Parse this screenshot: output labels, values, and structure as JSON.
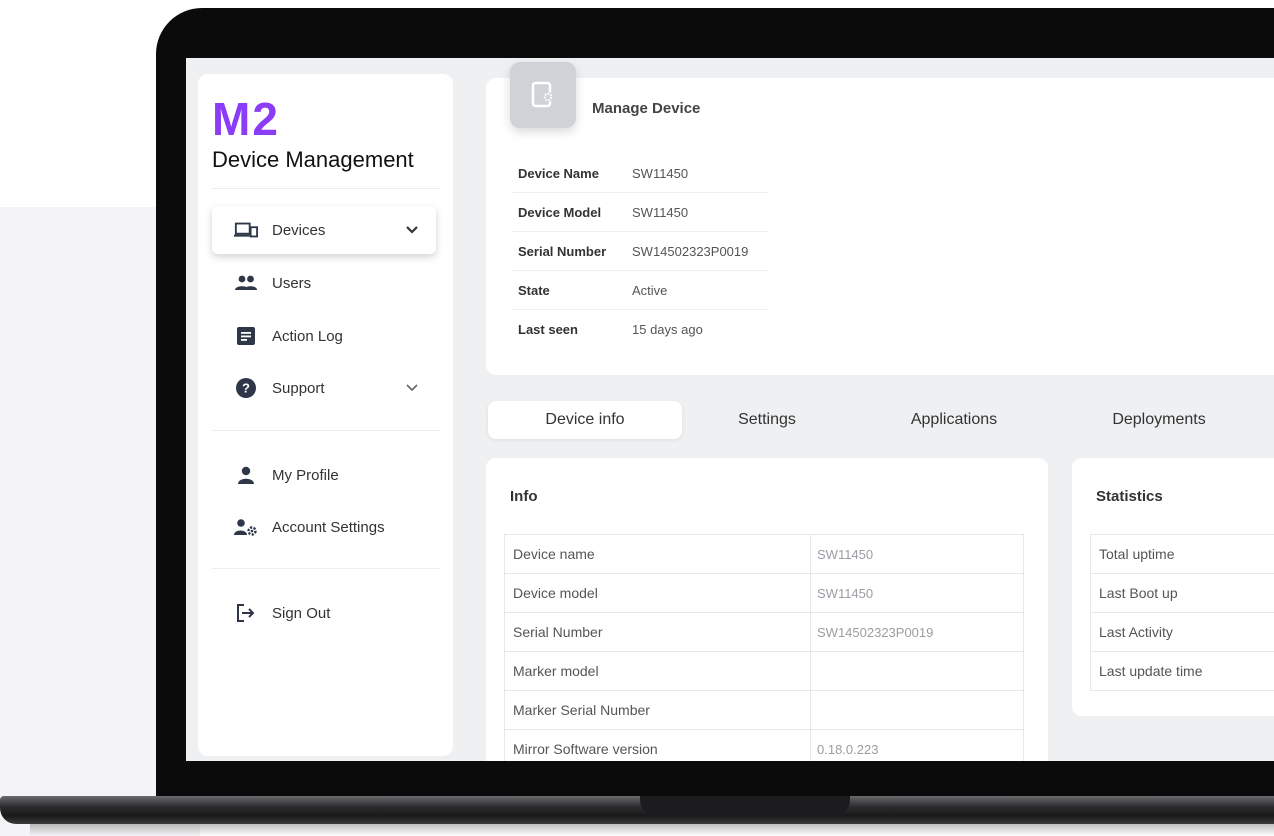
{
  "brand": {
    "mark": "M2",
    "title": "Device Management"
  },
  "sidebar": {
    "items": [
      {
        "label": "Devices",
        "icon": "devices-icon",
        "active": true,
        "has_chevron": true
      },
      {
        "label": "Users",
        "icon": "users-icon",
        "active": false,
        "has_chevron": false
      },
      {
        "label": "Action Log",
        "icon": "action-log-icon",
        "active": false,
        "has_chevron": false
      },
      {
        "label": "Support",
        "icon": "help-icon",
        "active": false,
        "has_chevron": true
      }
    ],
    "account_items": [
      {
        "label": "My Profile",
        "icon": "person-icon"
      },
      {
        "label": "Account Settings",
        "icon": "account-settings-icon"
      }
    ],
    "sign_out": {
      "label": "Sign Out",
      "icon": "sign-out-icon"
    }
  },
  "header": {
    "title": "Manage Device",
    "rows": [
      {
        "key": "Device Name",
        "value": "SW11450"
      },
      {
        "key": "Device Model",
        "value": "SW11450"
      },
      {
        "key": "Serial Number",
        "value": "SW14502323P0019"
      },
      {
        "key": "State",
        "value": "Active"
      },
      {
        "key": "Last seen",
        "value": "15 days ago"
      }
    ]
  },
  "tabs": [
    {
      "label": "Device info",
      "active": true
    },
    {
      "label": "Settings",
      "active": false
    },
    {
      "label": "Applications",
      "active": false
    },
    {
      "label": "Deployments",
      "active": false
    }
  ],
  "info": {
    "title": "Info",
    "rows": [
      {
        "key": "Device name",
        "value": "SW11450"
      },
      {
        "key": "Device model",
        "value": "SW11450"
      },
      {
        "key": "Serial Number",
        "value": "SW14502323P0019"
      },
      {
        "key": "Marker model",
        "value": ""
      },
      {
        "key": "Marker Serial Number",
        "value": ""
      },
      {
        "key": "Mirror Software version",
        "value": "0.18.0.223"
      }
    ]
  },
  "statistics": {
    "title": "Statistics",
    "rows": [
      {
        "key": "Total uptime"
      },
      {
        "key": "Last Boot up"
      },
      {
        "key": "Last Activity"
      },
      {
        "key": "Last update time"
      }
    ]
  },
  "colors": {
    "brand": "#8b3cf6",
    "screen_bg": "#eef0f2",
    "laptop": "#0b0b0c"
  }
}
